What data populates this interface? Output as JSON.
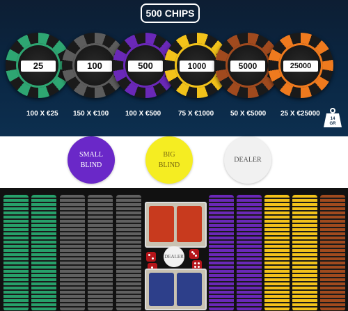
{
  "header": {
    "badge": "500 CHIPS"
  },
  "chips": [
    {
      "value": "25",
      "qty": "100 X €25",
      "color": "#2ea672"
    },
    {
      "value": "100",
      "qty": "150 X €100",
      "color": "#5c5c5c"
    },
    {
      "value": "500",
      "qty": "100 X €500",
      "color": "#6a28b8"
    },
    {
      "value": "1000",
      "qty": "75 X €1000",
      "color": "#f2c21a"
    },
    {
      "value": "5000",
      "qty": "50 X €5000",
      "color": "#a04a1e"
    },
    {
      "value": "25000",
      "qty": "25 X €25000",
      "color": "#ef7a1e"
    }
  ],
  "weight": {
    "value": "14",
    "unit": "GR"
  },
  "buttons": [
    {
      "line1": "SMALL",
      "line2": "BLIND",
      "color": "#6a28c8",
      "text_color": "#ffffff"
    },
    {
      "line1": "BIG",
      "line2": "BLIND",
      "color": "#f5ed22",
      "text_color": "#7a6a10"
    },
    {
      "line1": "DEALER",
      "line2": "",
      "color": "#f1f1f1",
      "text_color": "#555555"
    }
  ],
  "case": {
    "dealer_button": "DEALER",
    "stack_colors": [
      "#27a06a",
      "#27a06a",
      "#606060",
      "#606060",
      "#606060",
      "#6a28b8",
      "#6a28b8",
      "#f2c21a",
      "#f2c21a",
      "#a04a1e"
    ]
  }
}
